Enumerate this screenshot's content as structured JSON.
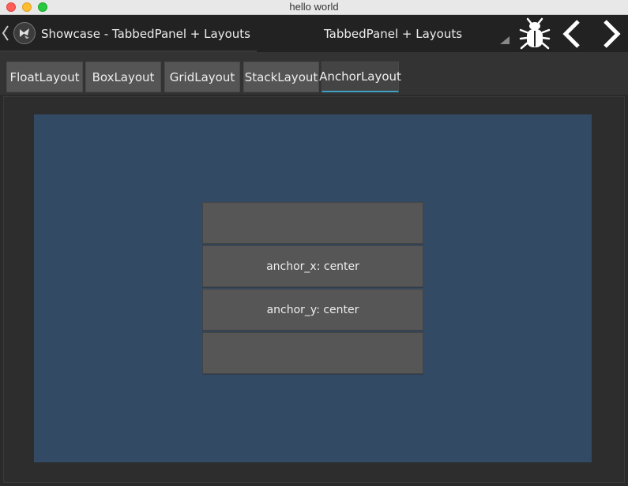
{
  "window": {
    "title": "hello world"
  },
  "actionbar": {
    "app_title": "Showcase - TabbedPanel + Layouts",
    "current_tab_title": "TabbedPanel + Layouts",
    "icons": [
      "chevron-left-icon",
      "kivy-logo-icon",
      "spinner-arrow-icon",
      "bug-icon",
      "chevron-left-icon",
      "chevron-right-icon"
    ]
  },
  "tabs": [
    {
      "label": "FloatLayout",
      "active": false
    },
    {
      "label": "BoxLayout",
      "active": false
    },
    {
      "label": "GridLayout",
      "active": false
    },
    {
      "label": "StackLayout",
      "active": false
    },
    {
      "label": "AnchorLayout",
      "active": true
    }
  ],
  "anchor_layout": {
    "buttons": [
      {
        "label": ""
      },
      {
        "label": "anchor_x: center"
      },
      {
        "label": "anchor_y: center"
      },
      {
        "label": ""
      }
    ]
  },
  "colors": {
    "accent": "#3fa0c4",
    "anchor_background": "#324a64",
    "button": "#565656",
    "actionbar": "#222222"
  }
}
